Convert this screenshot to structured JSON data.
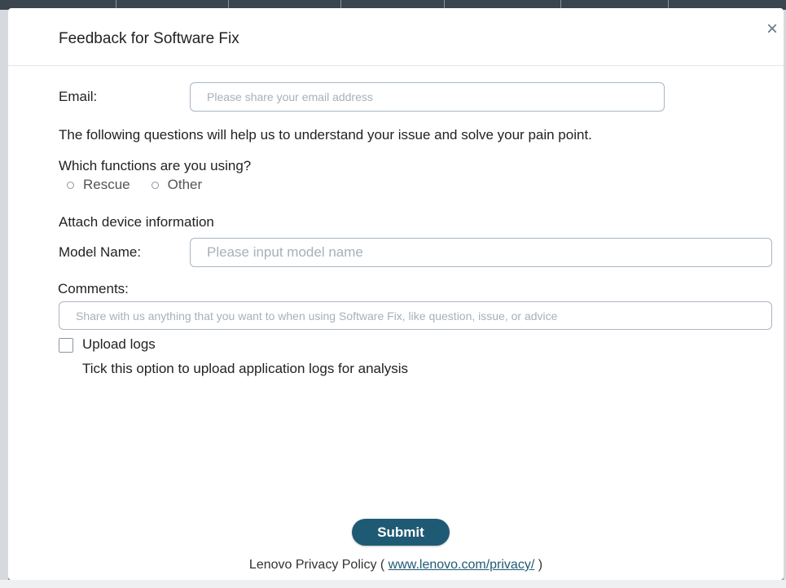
{
  "dialog": {
    "title": "Feedback for Software Fix",
    "close_symbol": "×"
  },
  "form": {
    "email_label": "Email:",
    "email_placeholder": "Please share your email address",
    "intro_text": "The following questions will help us to understand your issue and solve your pain point.",
    "functions_question": "Which functions are you using?",
    "function_options": [
      "Rescue",
      "Other"
    ],
    "attach_heading": "Attach device information",
    "model_label": "Model Name:",
    "model_placeholder": "Please input model name",
    "comments_label": "Comments:",
    "comments_placeholder": "Share with us anything that you want to when using Software Fix, like question, issue, or advice",
    "upload_label": "Upload logs",
    "upload_hint": "Tick this option to upload application logs for analysis",
    "submit_label": "Submit"
  },
  "footer": {
    "privacy_prefix": "Lenovo Privacy Policy ( ",
    "privacy_link": "www.lenovo.com/privacy/",
    "privacy_suffix": " )"
  },
  "colors": {
    "accent": "#1f5a74",
    "input_border": "#a9b6c3",
    "placeholder": "#a7b0b8"
  },
  "icons": {
    "close": "close-icon",
    "radio": "radio-unchecked-icon",
    "checkbox": "checkbox-unchecked-icon"
  }
}
